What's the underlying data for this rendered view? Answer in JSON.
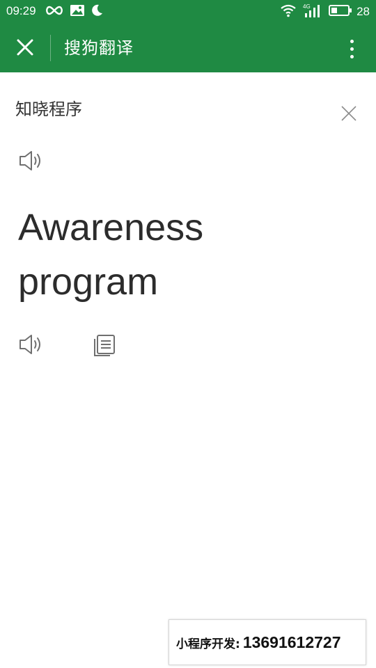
{
  "status_bar": {
    "time": "09:29",
    "battery_percent": "28",
    "network": "4G",
    "icons": [
      "infinity-icon",
      "image-icon",
      "moon-icon",
      "wifi-icon",
      "signal-icon",
      "battery-icon"
    ]
  },
  "app_bar": {
    "title": "搜狗翻译",
    "close_icon": "close-icon",
    "menu_icon": "more-vertical-icon"
  },
  "translator": {
    "source_text": "知晓程序",
    "translated_text": "Awareness program",
    "clear_icon": "clear-icon",
    "source_speaker_icon": "speaker-icon",
    "target_speaker_icon": "speaker-icon",
    "copy_icon": "copy-icon"
  },
  "footer": {
    "label": "小程序开发:",
    "phone": "13691612727"
  },
  "colors": {
    "brand_green": "#1f8a43",
    "text_dark": "#2c2c2c",
    "icon_gray": "#6f6f6f"
  }
}
